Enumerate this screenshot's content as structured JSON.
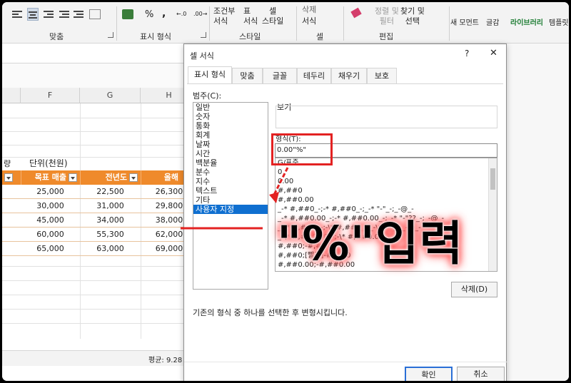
{
  "ribbon": {
    "groups": {
      "alignment": "맞춤",
      "number_format": "표시 형식",
      "styles": "스타일",
      "cells": "셀",
      "editing": "편집"
    },
    "styles_buttons": {
      "conditional": "조건부\n서식",
      "table": "표\n서식",
      "cell": "셀\n스타일"
    },
    "cells_buttons": {
      "delete": "삭제",
      "format": "서식"
    },
    "editing_buttons": {
      "sort": "정렬 및\n필터",
      "find": "찾기 및\n선택"
    },
    "right_buttons": {
      "comment": "새 모먼트",
      "templates": "글감",
      "library": "라이브러리",
      "template": "템플릿"
    },
    "percent": "%",
    "comma": ","
  },
  "sheet": {
    "columns": [
      "F",
      "G",
      "H"
    ],
    "label_left": "량",
    "unit_label": "단위(천원)",
    "headers": [
      "목표 매출",
      "전년도",
      "올해"
    ],
    "rows": [
      [
        "25,000",
        "22,500",
        "26,300"
      ],
      [
        "30,000",
        "31,000",
        "29,800"
      ],
      [
        "45,000",
        "34,000",
        "38,000"
      ],
      [
        "60,000",
        "55,300",
        "62,000"
      ],
      [
        "65,000",
        "63,000",
        "69,000"
      ]
    ],
    "status": "평균: 9.28"
  },
  "dialog": {
    "title": "셀 서식",
    "help": "?",
    "close": "✕",
    "tabs": [
      "표시 형식",
      "맞춤",
      "글꼴",
      "테두리",
      "채우기",
      "보호"
    ],
    "category_label": "범주(C):",
    "categories": [
      "일반",
      "숫자",
      "통화",
      "회계",
      "날짜",
      "시간",
      "백분율",
      "분수",
      "지수",
      "텍스트",
      "기타",
      "사용자 지정"
    ],
    "selected_category": "사용자 지정",
    "preview_label": "보기",
    "type_label": "형식(T):",
    "type_value": "0.00\"%\"",
    "formats": [
      "G/표준",
      "0",
      "0.00",
      "#,##0",
      "#,##0.00",
      "_-* #,##0_-;-* #,##0_-;_-* \"-\"_-;_-@_-",
      "_-* #,##0.00_-;-* #,##0.00_-;_-* \"-\"??_-;_-@_-",
      "_-\\* #,##0_-;-\\* #,##0_-;_-\\* \"-\"_-;_-@_-",
      "_-\\* #,##0.00_-;-\\* #,##0.00_-",
      "#,##0;-#,##0",
      "#,##0;[빨강]-#,##0",
      "#,##0.00;-#,##0.00"
    ],
    "delete_button": "삭제(D)",
    "description": "기존의 형식 중 하나를 선택한 후 변형시킵니다.",
    "ok": "확인",
    "cancel": "취소"
  },
  "overlay": {
    "caption": "\"%\"입력",
    "accent": "#e32222"
  }
}
